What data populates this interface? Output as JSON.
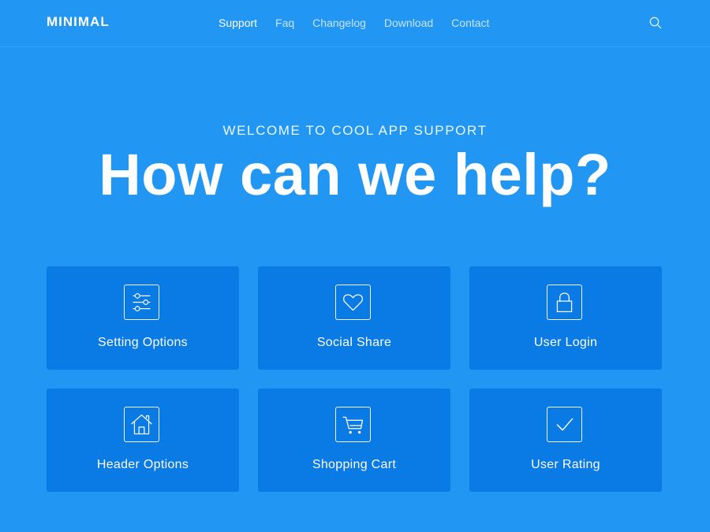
{
  "header": {
    "logo": "MINIMAL",
    "nav": [
      "Support",
      "Faq",
      "Changelog",
      "Download",
      "Contact"
    ],
    "active_nav": "Support",
    "search_icon": "search-icon"
  },
  "hero": {
    "kicker": "WELCOME TO COOL APP SUPPORT",
    "headline": "How can we help?"
  },
  "cards": [
    {
      "label": "Setting Options",
      "icon": "sliders-icon"
    },
    {
      "label": "Social Share",
      "icon": "heart-icon"
    },
    {
      "label": "User Login",
      "icon": "lock-icon"
    },
    {
      "label": "Header Options",
      "icon": "home-icon"
    },
    {
      "label": "Shopping Cart",
      "icon": "cart-icon"
    },
    {
      "label": "User Rating",
      "icon": "checkmark-icon"
    }
  ],
  "colors": {
    "background": "#2196f3",
    "card": "#0a7ae4",
    "text": "#ffffff"
  }
}
